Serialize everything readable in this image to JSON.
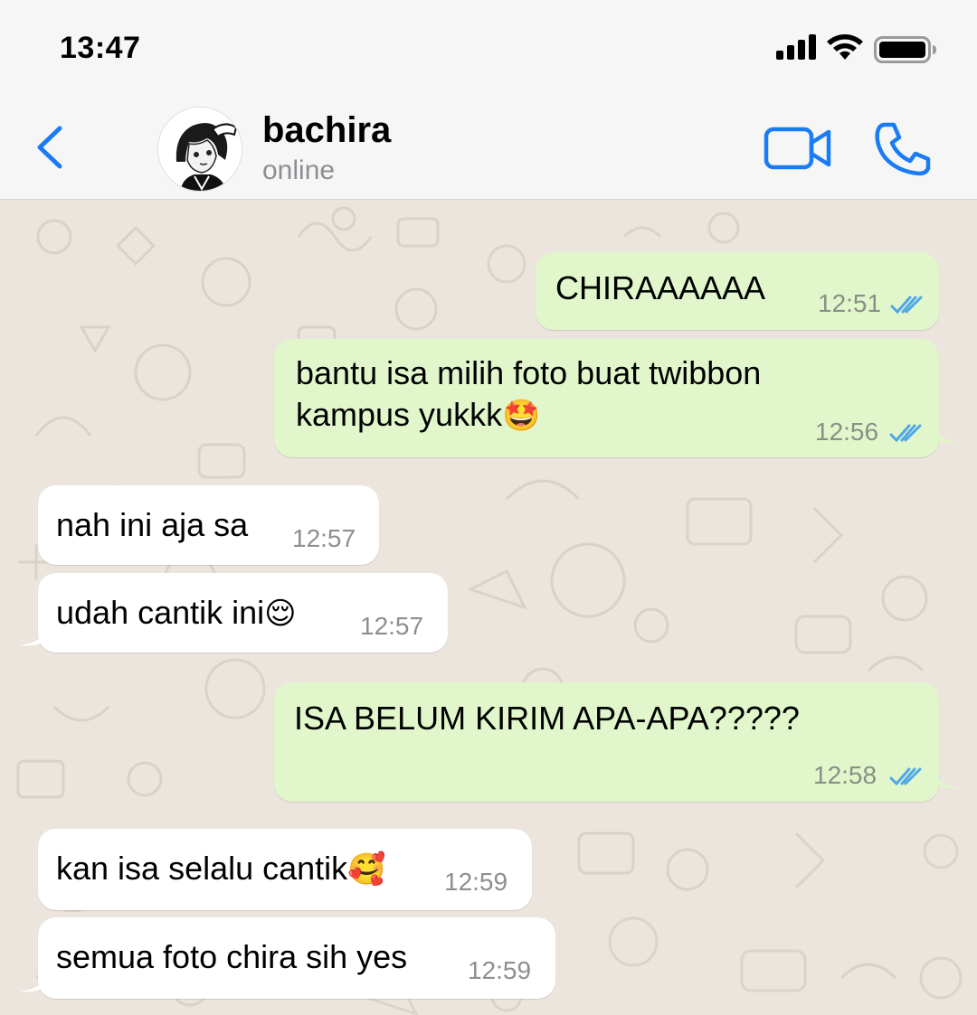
{
  "status_bar": {
    "time": "13:47"
  },
  "header": {
    "contact_name": "bachira",
    "contact_status": "online"
  },
  "colors": {
    "accent": "#1a7cf5",
    "outgoing_bubble": "#e1f7cb",
    "incoming_bubble": "#ffffff",
    "read_ticks": "#4fa8e8"
  },
  "messages": [
    {
      "direction": "out",
      "text": "CHIRAAAAAA",
      "time": "12:51"
    },
    {
      "direction": "out",
      "line1": "bantu isa milih foto buat twibbon",
      "line2": "kampus yukkk",
      "emoji": "🤩",
      "time": "12:56"
    },
    {
      "direction": "in",
      "text": "nah ini aja sa",
      "time": "12:57"
    },
    {
      "direction": "in",
      "text": "udah cantik ini",
      "emoji": "😌",
      "time": "12:57"
    },
    {
      "direction": "out",
      "text": "ISA BELUM KIRIM APA-APA?????",
      "time": "12:58"
    },
    {
      "direction": "in",
      "text": "kan isa selalu cantik",
      "emoji": "🥰",
      "time": "12:59"
    },
    {
      "direction": "in",
      "text": "semua foto chira sih yes",
      "time": "12:59"
    }
  ]
}
